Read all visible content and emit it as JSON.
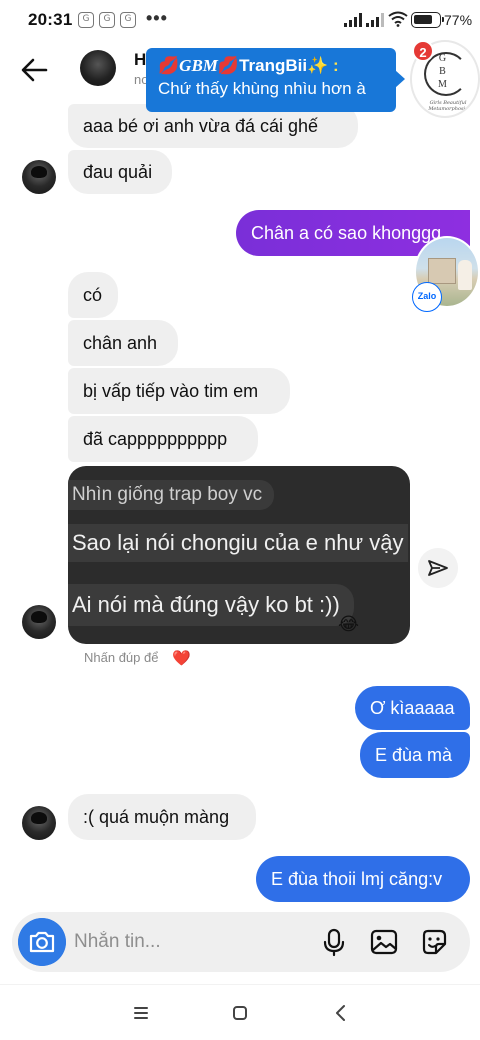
{
  "status_bar": {
    "time": "20:31",
    "battery_percent": "77%",
    "battery_level": 0.77,
    "notification_icons": [
      "G",
      "G",
      "G"
    ],
    "more_notifications": "•••"
  },
  "header": {
    "name_partial": "H",
    "status_partial": "no"
  },
  "notification": {
    "sender_prefix": "💋",
    "sender_gbm": "GBM",
    "sender_mid": "💋",
    "sender_name": "TrangBii",
    "sender_suffix": "✨ :",
    "message": "Chứ thấy khùng nhìu hơn à",
    "unread_count": "2",
    "logo_letters": "G\nB\nM",
    "logo_caption": "Girls Beautiful Metamorphosis"
  },
  "zalo_chathead": {
    "badge": "Zalo"
  },
  "messages": [
    {
      "id": "m1",
      "dir": "in",
      "text": "aaa bé ơi anh vừa đá cái ghế"
    },
    {
      "id": "m2",
      "dir": "in",
      "text": "đau quải"
    },
    {
      "id": "m3",
      "dir": "out",
      "text": "Chân a có sao khonggg"
    },
    {
      "id": "m4",
      "dir": "in",
      "text": "có"
    },
    {
      "id": "m5",
      "dir": "in",
      "text": "chân anh"
    },
    {
      "id": "m6",
      "dir": "in",
      "text": "bị vấp tiếp vào tim em"
    },
    {
      "id": "m7",
      "dir": "in",
      "text": "đã capppppppppp"
    },
    {
      "id": "m8",
      "dir": "out",
      "text": "Ơ kìaaaaa"
    },
    {
      "id": "m9",
      "dir": "out",
      "text": "E đùa mà"
    },
    {
      "id": "m10",
      "dir": "in",
      "text": ":( quá muộn màng"
    },
    {
      "id": "m11",
      "dir": "out",
      "text": "E đùa thoii lmj căng:v"
    }
  ],
  "image_message": {
    "line1": "Nhìn giống trap boy vc",
    "line2": "Sao lại nói chongiu của e như vậy",
    "line3": "Ai nói mà đúng vậy ko bt :))",
    "emoji": "😂"
  },
  "hint": {
    "text": "Nhấn đúp để",
    "heart": "❤️"
  },
  "composer": {
    "placeholder": "Nhắn tin...",
    "value": ""
  },
  "icons": {
    "back": "back-arrow-icon",
    "share": "send-icon",
    "camera": "camera-icon",
    "mic": "microphone-icon",
    "gallery": "gallery-icon",
    "sticker": "sticker-icon",
    "nav_menu": "menu-icon",
    "nav_home": "home-square-icon",
    "nav_back": "back-chevron-icon"
  },
  "colors": {
    "outgoing_purple": "#8a2be2",
    "outgoing_blue": "#2f6fe8",
    "incoming": "#efefef",
    "notification": "#1877d8",
    "accent": "#2f7ae5"
  }
}
